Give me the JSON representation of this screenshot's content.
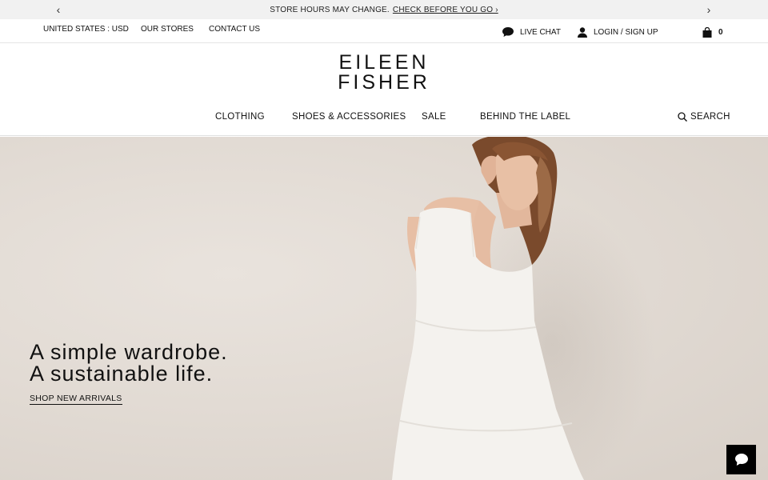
{
  "announcement": {
    "message": "STORE HOURS MAY CHANGE.",
    "link": "CHECK BEFORE YOU GO ›",
    "prev_icon": "chevron-left-icon",
    "next_icon": "chevron-right-icon"
  },
  "utility": {
    "locale": "UNITED STATES : USD",
    "stores": "OUR STORES",
    "contact": "CONTACT US",
    "live_chat": "LIVE CHAT",
    "login": "LOGIN / SIGN UP",
    "cart_count": "0"
  },
  "logo": {
    "line1": "EILEEN",
    "line2": "FISHER"
  },
  "nav": {
    "items": [
      "CLOTHING",
      "SHOES & ACCESSORIES",
      "SALE",
      "BEHIND THE LABEL"
    ],
    "search": "SEARCH"
  },
  "hero": {
    "headline_1": "A simple wardrobe.",
    "headline_2": "A sustainable life.",
    "cta": "SHOP NEW ARRIVALS"
  },
  "colors": {
    "announce_bg": "#f1f1f1",
    "text": "#111111",
    "hero_bg": "#e2dbd4",
    "chat_button": "#000000"
  }
}
